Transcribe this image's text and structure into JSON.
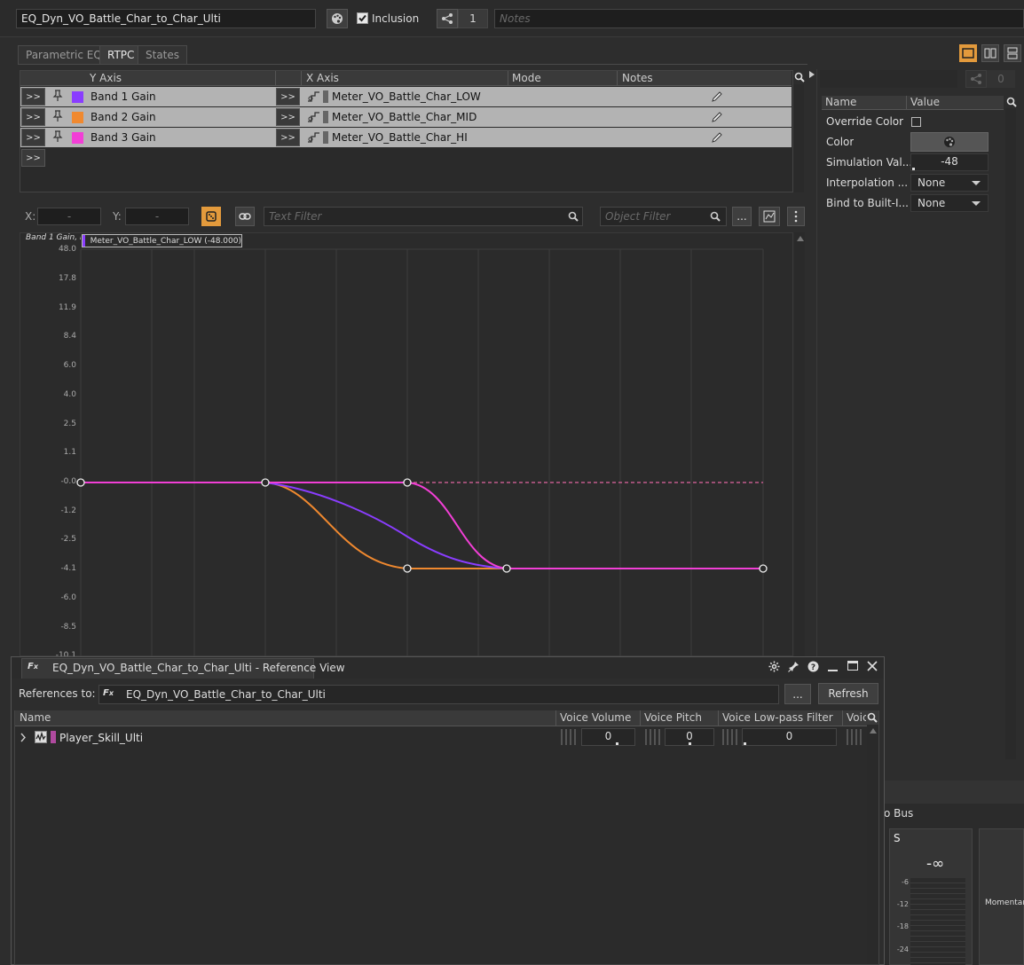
{
  "top_bar": {
    "object_name": "EQ_Dyn_VO_Battle_Char_to_Char_Ulti",
    "inclusion_label": "Inclusion",
    "inclusion_checked": true,
    "share_count": "1",
    "notes_placeholder": "Notes"
  },
  "tabs": [
    {
      "label": "Parametric EQ"
    },
    {
      "label": "RTPC"
    },
    {
      "label": "States"
    }
  ],
  "rtpc_table": {
    "headers": {
      "y_axis": "Y Axis",
      "x_axis": "X Axis",
      "mode": "Mode",
      "notes": "Notes"
    },
    "expand_label": ">>",
    "rows": [
      {
        "y_axis": "Band 1 Gain",
        "color": "#8a3dff",
        "x_axis": "Meter_VO_Battle_Char_LOW"
      },
      {
        "y_axis": "Band 2 Gain",
        "color": "#f0892f",
        "x_axis": "Meter_VO_Battle_Char_MID"
      },
      {
        "y_axis": "Band 3 Gain",
        "color": "#f23fd6",
        "x_axis": "Meter_VO_Battle_Char_HI"
      }
    ]
  },
  "graph_toolbar": {
    "x_label": "X:",
    "x_value": "-",
    "y_label": "Y:",
    "y_value": "-",
    "text_filter_placeholder": "Text Filter",
    "object_filter_placeholder": "Object Filter",
    "more_label": "..."
  },
  "graph": {
    "header_label": "Band 1 Gain, Ba",
    "tooltip": "Meter_VO_Battle_Char_LOW (-48.000)",
    "y_ticks": [
      "48.0",
      "17.8",
      "11.9",
      "8.4",
      "6.0",
      "4.0",
      "2.5",
      "1.1",
      "-0.0",
      "-1.2",
      "-2.5",
      "-4.1",
      "-6.0",
      "-8.5",
      "-10.1"
    ],
    "colors": {
      "band1": "#8a3dff",
      "band2": "#f0892f",
      "band3": "#f23fd6"
    }
  },
  "properties": {
    "share_count": "0",
    "headers": {
      "name": "Name",
      "value": "Value"
    },
    "override_color_label": "Override Color",
    "override_color_checked": false,
    "color_label": "Color",
    "simulation_label": "Simulation Val...",
    "simulation_value": "-48",
    "interpolation_label": "Interpolation ...",
    "interpolation_value": "None",
    "bind_label": "Bind to Built-I...",
    "bind_value": "None"
  },
  "reference_view": {
    "title": "EQ_Dyn_VO_Battle_Char_to_Char_Ulti - Reference View",
    "references_label": "References to:",
    "references_value": "EQ_Dyn_VO_Battle_Char_to_Char_Ulti",
    "more_label": "...",
    "refresh_label": "Refresh",
    "columns": [
      "Name",
      "Voice Volume",
      "Voice Pitch",
      "Voice Low-pass Filter",
      "Voic"
    ],
    "rows": [
      {
        "name": "Player_Skill_Ulti",
        "voice_volume": "0",
        "voice_pitch": "0",
        "voice_lpf": "0"
      }
    ]
  },
  "bottom_right": {
    "bus_label": "o Bus",
    "channel_label": "S",
    "peak_value": "-∞",
    "scale": [
      "-6",
      "-12",
      "-18",
      "-24"
    ],
    "loudness_label": "Momentary"
  }
}
